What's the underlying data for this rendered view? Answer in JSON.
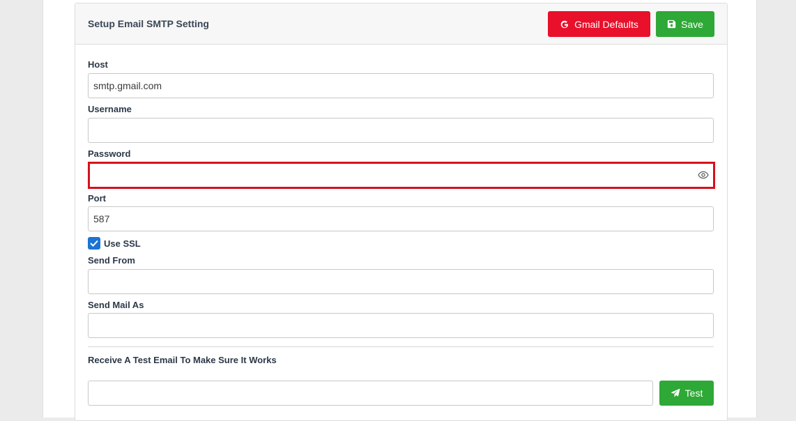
{
  "card": {
    "title": "Setup Email SMTP Setting",
    "gmail_defaults_label": "Gmail Defaults",
    "save_label": "Save"
  },
  "fields": {
    "host": {
      "label": "Host",
      "value": "smtp.gmail.com"
    },
    "username": {
      "label": "Username",
      "value": ""
    },
    "password": {
      "label": "Password",
      "value": ""
    },
    "port": {
      "label": "Port",
      "value": "587"
    },
    "use_ssl": {
      "label": "Use SSL",
      "checked": true
    },
    "send_from": {
      "label": "Send From",
      "value": ""
    },
    "send_mail_as": {
      "label": "Send Mail As",
      "value": ""
    }
  },
  "test": {
    "label": "Receive A Test Email To Make Sure It Works",
    "value": "",
    "button_label": "Test"
  },
  "colors": {
    "gmail_button": "#e8102a",
    "save_button": "#2ea836",
    "test_button": "#2ea836",
    "password_highlight": "#d7101e",
    "checkbox": "#1b74d4"
  },
  "icons": {
    "gmail": "google-g-icon",
    "save": "floppy-disk-icon",
    "password_toggle": "eye-icon",
    "checkbox": "checkmark-icon",
    "test": "paper-plane-icon"
  }
}
